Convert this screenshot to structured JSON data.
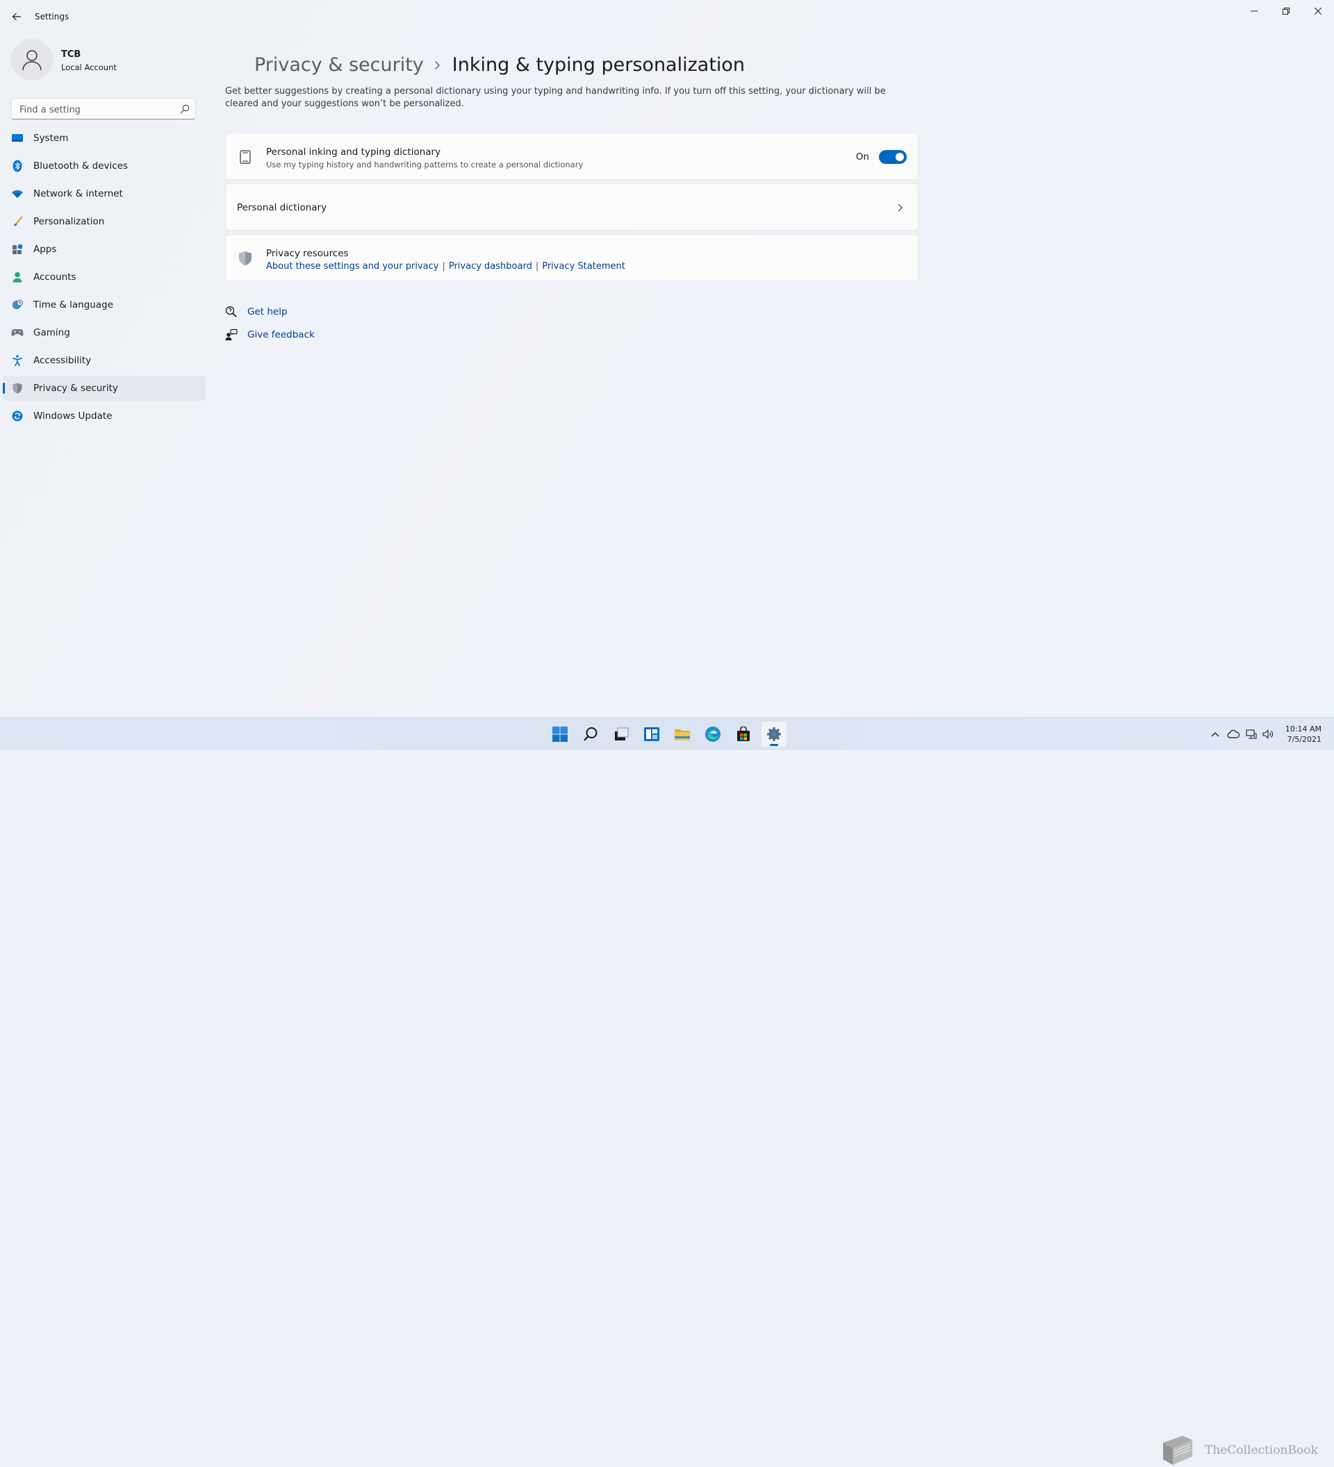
{
  "window": {
    "title": "Settings",
    "controls": {
      "minimize": "minimize",
      "maximize": "restore",
      "close": "close"
    }
  },
  "user": {
    "name": "TCB",
    "account_type": "Local Account"
  },
  "search": {
    "placeholder": "Find a setting"
  },
  "sidebar": {
    "items": [
      {
        "label": "System",
        "icon": "monitor-icon"
      },
      {
        "label": "Bluetooth & devices",
        "icon": "bluetooth-icon"
      },
      {
        "label": "Network & internet",
        "icon": "wifi-icon"
      },
      {
        "label": "Personalization",
        "icon": "brush-icon"
      },
      {
        "label": "Apps",
        "icon": "apps-icon"
      },
      {
        "label": "Accounts",
        "icon": "person-icon"
      },
      {
        "label": "Time & language",
        "icon": "globe-clock-icon"
      },
      {
        "label": "Gaming",
        "icon": "gamepad-icon"
      },
      {
        "label": "Accessibility",
        "icon": "accessibility-icon"
      },
      {
        "label": "Privacy & security",
        "icon": "shield-icon",
        "active": true
      },
      {
        "label": "Windows Update",
        "icon": "update-icon"
      }
    ]
  },
  "page": {
    "breadcrumb_parent": "Privacy & security",
    "title": "Inking & typing personalization",
    "description": "Get better suggestions by creating a personal dictionary using your typing and handwriting info. If you turn off this setting, your dictionary will be cleared and your suggestions won’t be personalized."
  },
  "settings": {
    "dictionary_toggle": {
      "title": "Personal inking and typing dictionary",
      "subtitle": "Use my typing history and handwriting patterns to create a personal dictionary",
      "state_label": "On",
      "enabled": true
    },
    "personal_dictionary": {
      "title": "Personal dictionary"
    },
    "privacy_resources": {
      "title": "Privacy resources",
      "links": [
        "About these settings and your privacy",
        "Privacy dashboard",
        "Privacy Statement"
      ]
    }
  },
  "help": {
    "get_help": "Get help",
    "give_feedback": "Give feedback"
  },
  "taskbar": {
    "apps": [
      "start-icon",
      "search-icon",
      "task-view-icon",
      "widgets-icon",
      "file-explorer-icon",
      "edge-icon",
      "store-icon",
      "settings-icon"
    ],
    "active_app": "settings-icon",
    "clock": {
      "time": "10:14 AM",
      "date": "7/5/2021"
    }
  },
  "watermark": {
    "text": "TheCollectionBook"
  },
  "colors": {
    "accent": "#0067c0",
    "link": "#003e92",
    "background": "#eef2f8",
    "card": "#fbfbfb"
  }
}
